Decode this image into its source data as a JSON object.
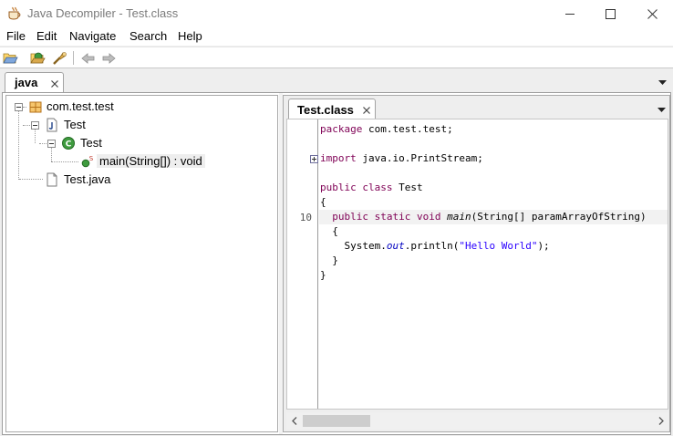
{
  "window": {
    "title": "Java Decompiler - Test.class",
    "controls": {
      "minimize": "minimize",
      "maximize": "maximize",
      "close": "close"
    }
  },
  "menu": {
    "items": [
      "File",
      "Edit",
      "Navigate",
      "Search",
      "Help"
    ]
  },
  "toolbar": {
    "buttons": [
      {
        "icon": "open-folder-icon"
      },
      {
        "icon": "open-type-icon"
      },
      {
        "icon": "search-icon"
      },
      {
        "icon": "back-arrow-icon"
      },
      {
        "icon": "forward-arrow-icon"
      }
    ]
  },
  "outer_tabs": [
    {
      "label": "java",
      "active": true
    }
  ],
  "tree": {
    "nodes": [
      {
        "label": "com.test.test",
        "icon": "package-icon",
        "expanded": true
      },
      {
        "label": "Test",
        "icon": "java-file-icon",
        "expanded": true
      },
      {
        "label": "Test",
        "icon": "class-icon",
        "expanded": true
      },
      {
        "label": "main(String[]) : void",
        "icon": "static-method-icon",
        "selected": true
      },
      {
        "label": "Test.java",
        "icon": "file-icon"
      }
    ]
  },
  "editor": {
    "tabs": [
      {
        "label": "Test.class",
        "active": true
      }
    ],
    "line_numbers": [
      {
        "line": 6,
        "number": "10"
      }
    ],
    "code": [
      [
        {
          "t": "package",
          "c": "kw"
        },
        {
          "t": " com.test.test;",
          "c": ""
        }
      ],
      [],
      [
        {
          "t": "import",
          "c": "kw"
        },
        {
          "t": " java.io.PrintStream;",
          "c": ""
        }
      ],
      [],
      [
        {
          "t": "public class",
          "c": "kw"
        },
        {
          "t": " Test",
          "c": ""
        }
      ],
      [
        {
          "t": "{",
          "c": ""
        }
      ],
      [
        {
          "t": "  ",
          "c": ""
        },
        {
          "t": "public static void",
          "c": "kw"
        },
        {
          "t": " ",
          "c": ""
        },
        {
          "t": "main",
          "c": "mtd"
        },
        {
          "t": "(String[] paramArrayOfString)",
          "c": ""
        }
      ],
      [
        {
          "t": "  {",
          "c": ""
        }
      ],
      [
        {
          "t": "    System.",
          "c": ""
        },
        {
          "t": "out",
          "c": "fld"
        },
        {
          "t": ".println(",
          "c": ""
        },
        {
          "t": "\"Hello World\"",
          "c": "str"
        },
        {
          "t": ");",
          "c": ""
        }
      ],
      [
        {
          "t": "  }",
          "c": ""
        }
      ],
      [
        {
          "t": "}",
          "c": ""
        }
      ]
    ],
    "highlighted_line": 6,
    "fold_line": 2
  },
  "colors": {
    "keyword": "#7f0055",
    "string": "#2a00ff",
    "field": "#0000c0",
    "package_icon": "#d88a17",
    "class_icon": "#3f9b3f"
  }
}
